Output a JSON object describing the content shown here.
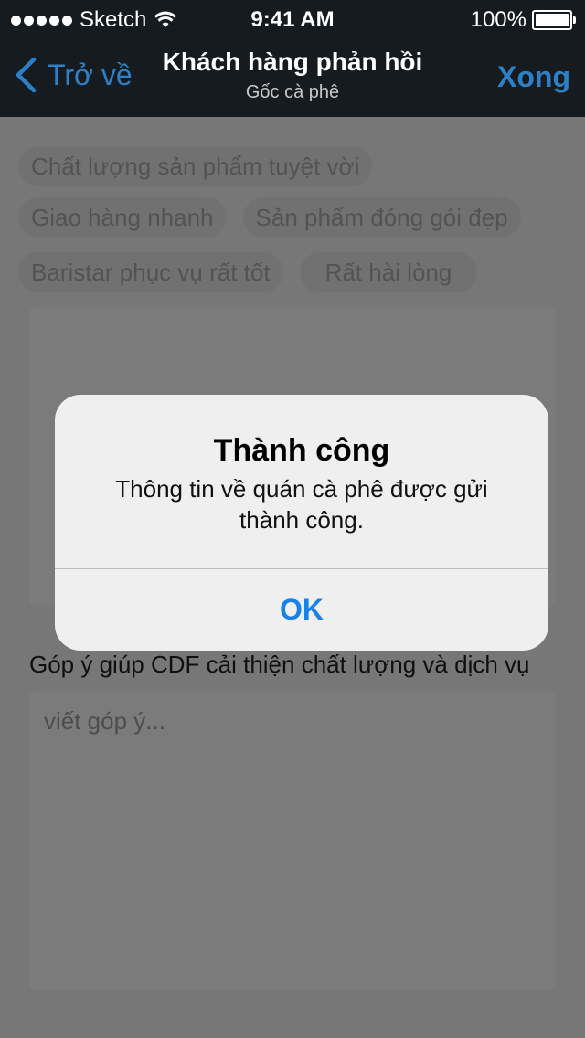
{
  "status_bar": {
    "carrier": "Sketch",
    "time": "9:41 AM",
    "battery": "100%",
    "battery_level": 1.0
  },
  "nav": {
    "back_label": "Trở về",
    "title": "Khách hàng phản hồi",
    "subtitle": "Gốc cà phê",
    "done_label": "Xong"
  },
  "tags": [
    "Chất lượng sản phẩm tuyệt vời",
    "Giao hàng nhanh",
    "Sản phẩm đóng gói đẹp",
    "Baristar phục vụ rất tốt",
    "Rất hài lòng"
  ],
  "feedback": {
    "label": "Góp ý giúp CDF cải thiện chất lượng và dịch vụ",
    "placeholder": "viết góp ý..."
  },
  "alert": {
    "title": "Thành công",
    "message": "Thông tin về quán cà phê được gửi thành công.",
    "ok_label": "OK"
  },
  "colors": {
    "accent": "#2d80c6",
    "alert_button": "#1782ea",
    "nav_background": "#161b20"
  }
}
